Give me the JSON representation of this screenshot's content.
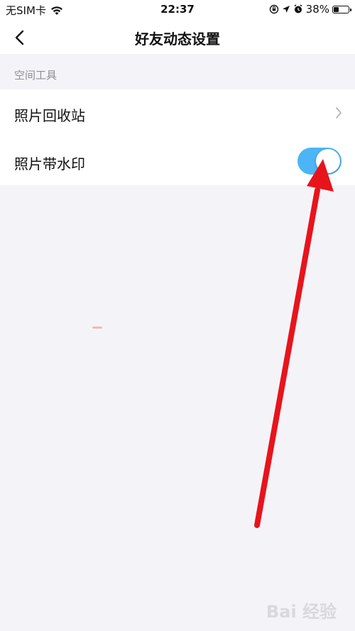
{
  "status_bar": {
    "carrier": "无SIM卡",
    "time": "22:37",
    "battery": "38%",
    "battery_level": 0.38
  },
  "nav": {
    "title": "好友动态设置"
  },
  "section": {
    "header": "空间工具"
  },
  "settings": {
    "items": [
      {
        "label": "照片回收站",
        "control": "chevron"
      },
      {
        "label": "照片带水印",
        "control": "toggle",
        "state": "on"
      }
    ]
  },
  "colors": {
    "toggle_on": "#4cb5f5",
    "annotation_arrow": "#e8141c",
    "background": "#f4f4f8"
  },
  "watermark": {
    "text": "Bai 经验"
  }
}
